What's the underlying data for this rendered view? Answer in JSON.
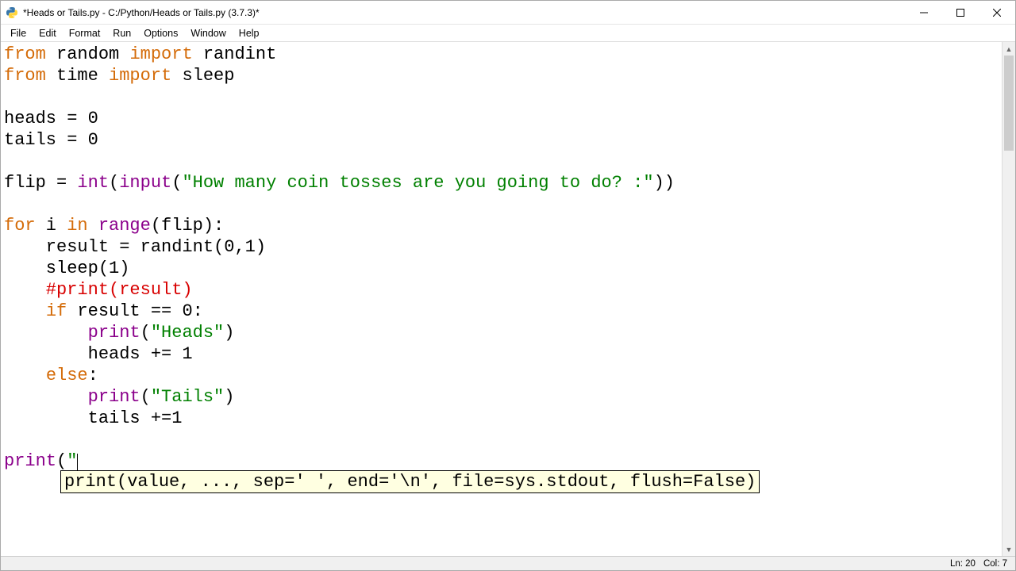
{
  "window": {
    "title": "*Heads or Tails.py - C:/Python/Heads or Tails.py (3.7.3)*"
  },
  "menu": {
    "file": "File",
    "edit": "Edit",
    "format": "Format",
    "run": "Run",
    "options": "Options",
    "window": "Window",
    "help": "Help"
  },
  "code": {
    "l1_from": "from",
    "l1_mod": " random ",
    "l1_import": "import",
    "l1_name": " randint",
    "l2_from": "from",
    "l2_mod": " time ",
    "l2_import": "import",
    "l2_name": " sleep",
    "l4": "heads = 0",
    "l5": "tails = 0",
    "l7a": "flip = ",
    "l7_int": "int",
    "l7b": "(",
    "l7_input": "input",
    "l7c": "(",
    "l7_str": "\"How many coin tosses are you going to do? :\"",
    "l7d": "))",
    "l9_for": "for",
    "l9a": " i ",
    "l9_in": "in",
    "l9b": " ",
    "l9_range": "range",
    "l9c": "(flip):",
    "l10": "    result = randint(0,1)",
    "l11": "    sleep(1)",
    "l12": "    #print(result)",
    "l13a": "    ",
    "l13_if": "if",
    "l13b": " result == 0:",
    "l14a": "        ",
    "l14_print": "print",
    "l14b": "(",
    "l14_str": "\"Heads\"",
    "l14c": ")",
    "l15": "        heads += 1",
    "l16a": "    ",
    "l16_else": "else",
    "l16b": ":",
    "l17a": "        ",
    "l17_print": "print",
    "l17b": "(",
    "l17_str": "\"Tails\"",
    "l17c": ")",
    "l18": "        tails +=1",
    "l20_print": "print",
    "l20a": "(",
    "l20_str": "\""
  },
  "calltip": {
    "text": "print(value, ..., sep=' ', end='\\n', file=sys.stdout, flush=False)"
  },
  "status": {
    "ln": "Ln: 20",
    "col": "Col: 7"
  }
}
